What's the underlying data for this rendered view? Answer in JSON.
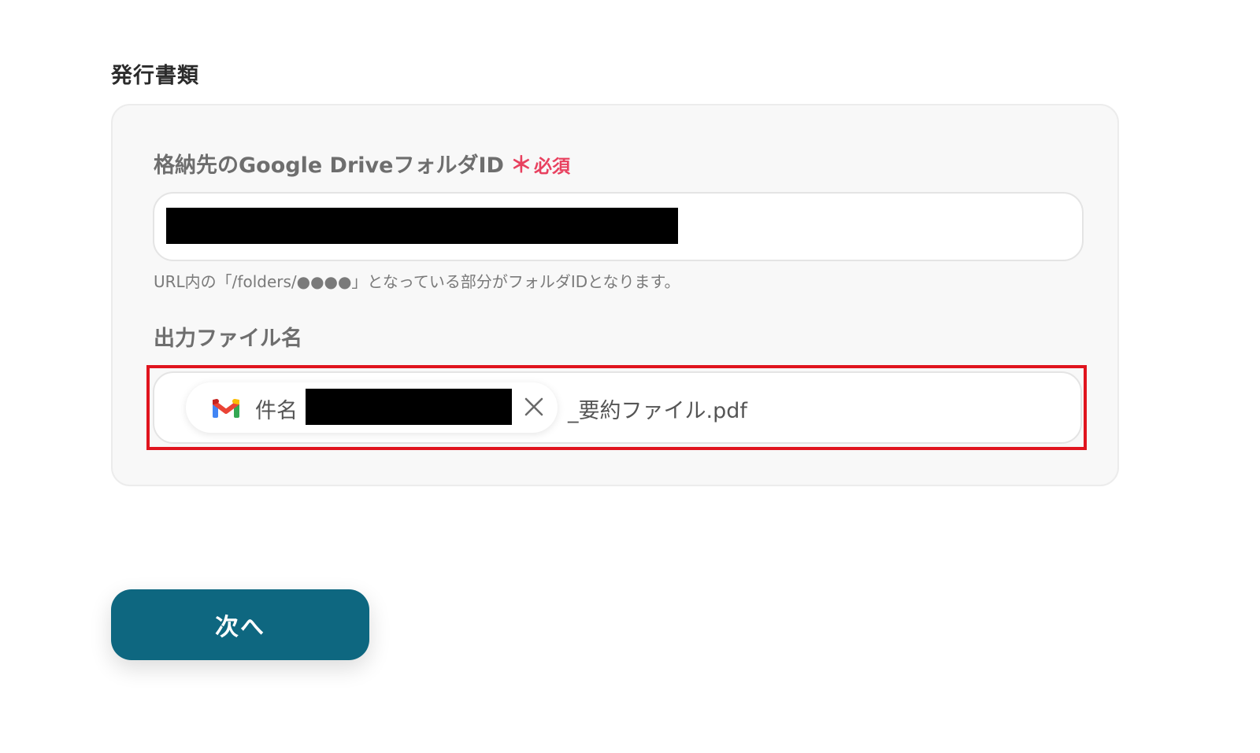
{
  "section": {
    "title": "発行書類"
  },
  "folder_field": {
    "label": "格納先のGoogle DriveフォルダID",
    "required_marker": "＊",
    "required_text": "必須",
    "value": "",
    "helper": "URL内の「/folders/●●●●」となっている部分がフォルダIDとなります。"
  },
  "filename_field": {
    "label": "出力ファイル名",
    "chip": {
      "icon": "gmail-icon",
      "label": "件名",
      "value": ""
    },
    "suffix": "_要約ファイル.pdf"
  },
  "actions": {
    "next_label": "次へ"
  },
  "colors": {
    "accent": "#0e6780",
    "required": "#e8415f",
    "highlight": "#e0141e"
  }
}
